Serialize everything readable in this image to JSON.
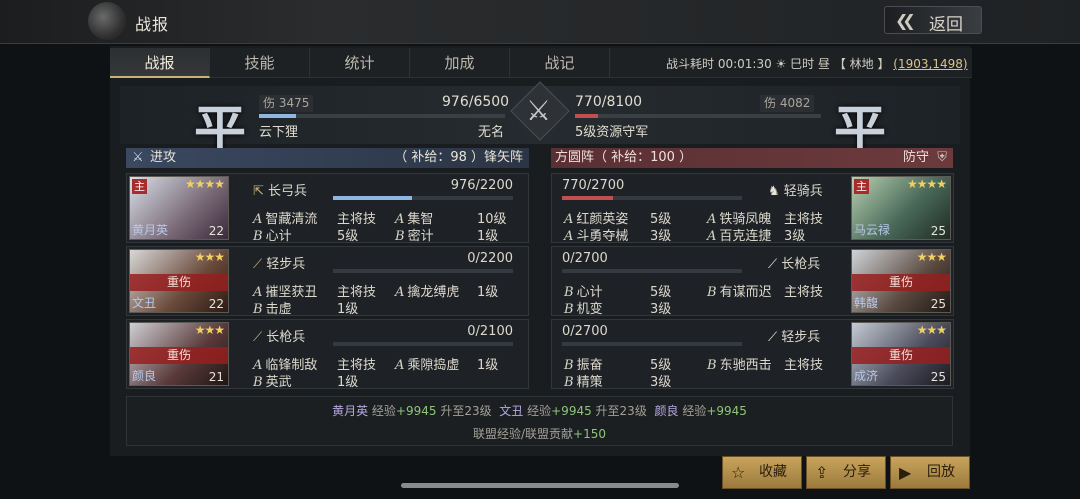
{
  "header": {
    "title": "战报",
    "back_label": "返回"
  },
  "tabs": [
    "战报",
    "技能",
    "统计",
    "加成",
    "战记"
  ],
  "battle_info": {
    "duration_label": "战斗耗时",
    "duration": "00:01:30",
    "time": "巳时 昼",
    "terrain": "【 林地 】",
    "coords": "(1903,1498)"
  },
  "attacker": {
    "emblem": "平",
    "damage_label": "伤",
    "damage": "3475",
    "troops": "976/6500",
    "troop_ratio": 0.15,
    "name": "云下狸",
    "faction": "无名"
  },
  "defender": {
    "emblem": "平",
    "damage_label": "伤",
    "damage": "4082",
    "troops": "770/8100",
    "troop_ratio": 0.095,
    "name": "5级资源守军"
  },
  "left_header": {
    "title": "进攻",
    "supply": "（ 补给：98 ）锋矢阵"
  },
  "right_header": {
    "title": "方圆阵（ 补给：100 ）",
    "stance": "防守"
  },
  "left_units": [
    {
      "name": "黄月英",
      "level": "22",
      "lead": "主",
      "stars": "★★★★",
      "injured": "",
      "troop_type": "长弓兵",
      "troops": "976/2200",
      "ratio": 0.44,
      "skills": [
        [
          "A",
          "智藏清流",
          "主将技"
        ],
        [
          "A",
          "集智",
          "10级"
        ],
        [
          "B",
          "心计",
          "5级"
        ],
        [
          "B",
          "密计",
          "1级"
        ]
      ]
    },
    {
      "name": "文丑",
      "level": "22",
      "lead": "",
      "stars": "★★★",
      "injured": "重伤",
      "troop_type": "轻步兵",
      "troops": "0/2200",
      "ratio": 0,
      "skills": [
        [
          "A",
          "摧坚获丑",
          "主将技"
        ],
        [
          "A",
          "擒龙缚虎",
          "1级"
        ],
        [
          "B",
          "击虚",
          "1级"
        ]
      ]
    },
    {
      "name": "颜良",
      "level": "21",
      "lead": "",
      "stars": "★★★",
      "injured": "重伤",
      "troop_type": "长枪兵",
      "troops": "0/2100",
      "ratio": 0,
      "skills": [
        [
          "A",
          "临锋制敌",
          "主将技"
        ],
        [
          "A",
          "乘隙捣虚",
          "1级"
        ],
        [
          "B",
          "英武",
          "1级"
        ]
      ]
    }
  ],
  "right_units": [
    {
      "name": "马云禄",
      "level": "25",
      "lead": "主",
      "stars": "★★★★",
      "injured": "",
      "troop_type": "轻骑兵",
      "troops": "770/2700",
      "ratio": 0.285,
      "skills": [
        [
          "A",
          "红颜英姿",
          "5级"
        ],
        [
          "A",
          "铁骑凤魄",
          "主将技"
        ],
        [
          "A",
          "斗勇夺械",
          "3级"
        ],
        [
          "A",
          "百克连捷",
          "3级"
        ]
      ]
    },
    {
      "name": "韩馥",
      "level": "25",
      "lead": "",
      "stars": "★★★",
      "injured": "重伤",
      "troop_type": "长枪兵",
      "troops": "0/2700",
      "ratio": 0,
      "skills": [
        [
          "B",
          "心计",
          "5级"
        ],
        [
          "B",
          "有谋而迟",
          "主将技"
        ],
        [
          "B",
          "机变",
          "3级"
        ]
      ]
    },
    {
      "name": "成济",
      "level": "25",
      "lead": "",
      "stars": "★★★",
      "injured": "重伤",
      "troop_type": "轻步兵",
      "troops": "0/2700",
      "ratio": 0,
      "skills": [
        [
          "B",
          "振奋",
          "5级"
        ],
        [
          "B",
          "东驰西击",
          "主将技"
        ],
        [
          "B",
          "精策",
          "3级"
        ]
      ]
    }
  ],
  "experience": {
    "entries": [
      {
        "name": "黄月英",
        "label": "经验",
        "gain": "+9945",
        "levelup": "升至23级"
      },
      {
        "name": "文丑",
        "label": "经验",
        "gain": "+9945",
        "levelup": "升至23级"
      },
      {
        "name": "颜良",
        "label": "经验",
        "gain": "+9945",
        "levelup": ""
      }
    ],
    "alliance_label": "联盟经验/联盟贡献",
    "alliance_gain": "+150"
  },
  "buttons": {
    "favorite": "收藏",
    "share": "分享",
    "replay": "回放"
  },
  "colors": {
    "accent_gold": "#c9b27a",
    "attacker_blue": "#3a4860",
    "defender_red": "#6c3a3c",
    "hp_blue": "#8fb6e0",
    "hp_red": "#c05050",
    "exp_green": "#8fc47a"
  }
}
